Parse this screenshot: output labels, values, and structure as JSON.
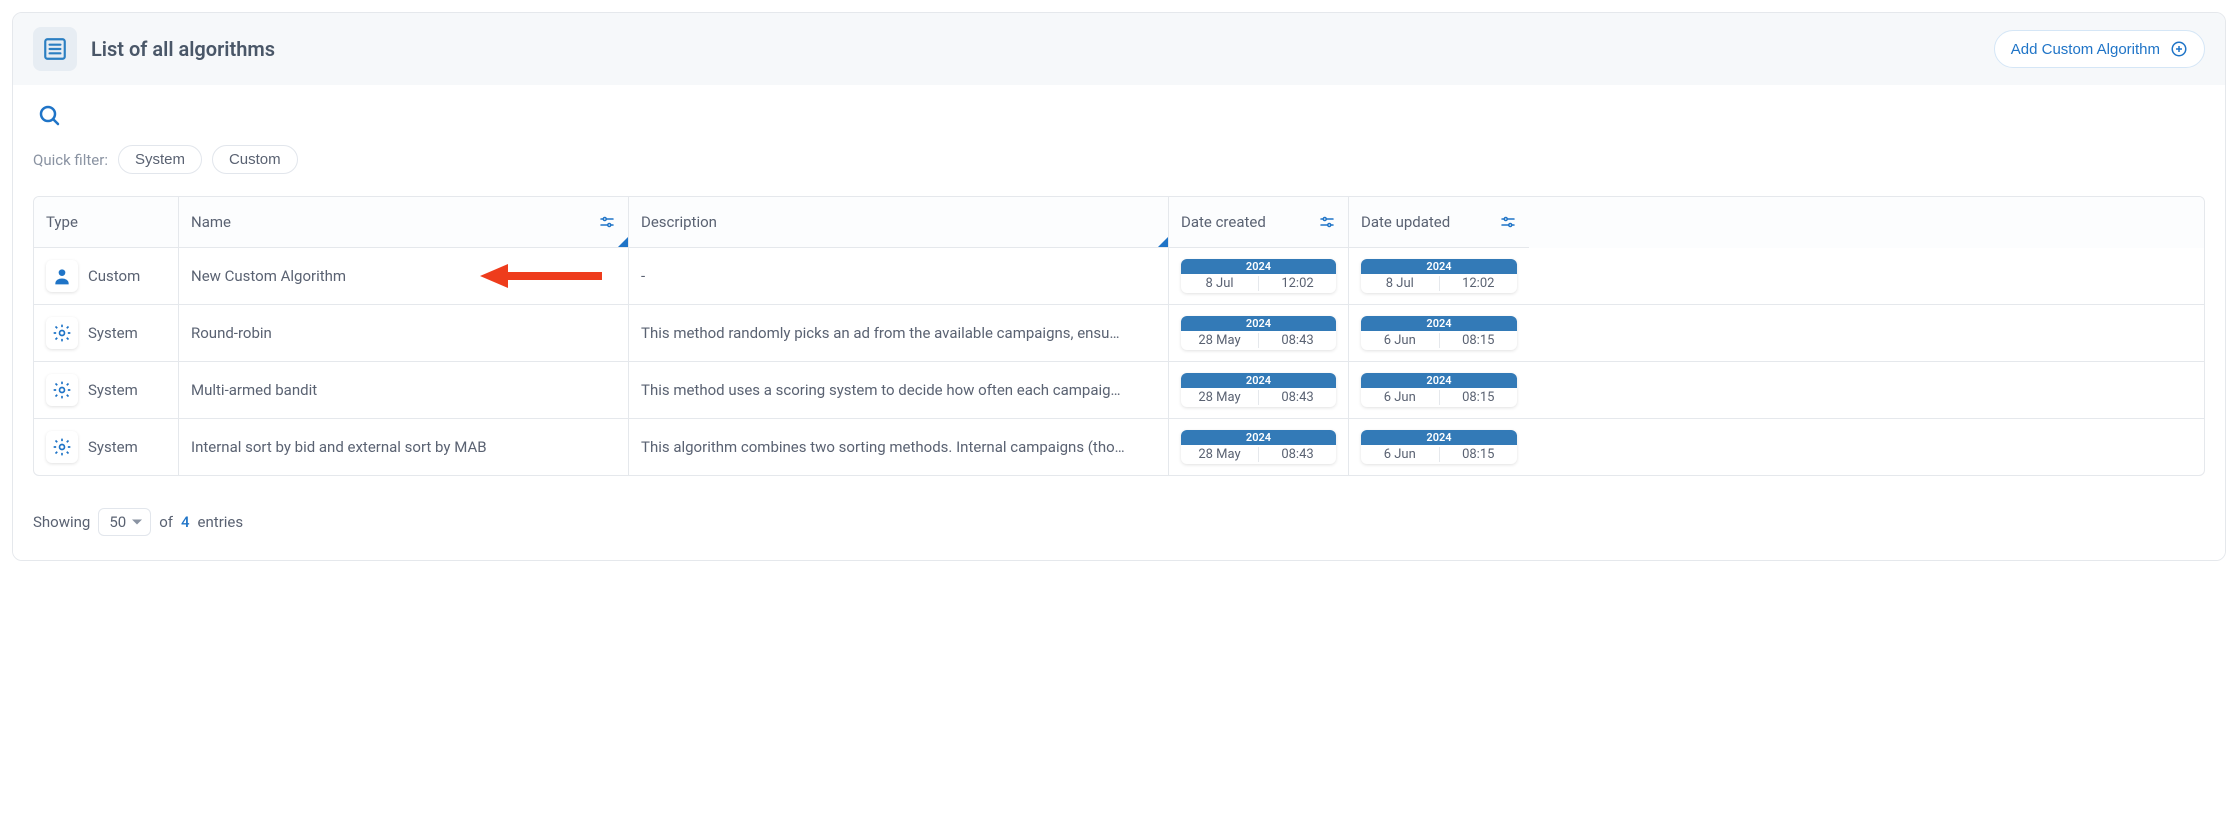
{
  "header": {
    "title": "List of all algorithms",
    "add_button_label": "Add Custom Algorithm"
  },
  "filters": {
    "quick_filter_label": "Quick filter:",
    "chips": [
      "System",
      "Custom"
    ]
  },
  "columns": {
    "type": "Type",
    "name": "Name",
    "description": "Description",
    "date_created": "Date created",
    "date_updated": "Date updated"
  },
  "rows": [
    {
      "type_label": "Custom",
      "type_icon": "user-icon",
      "name": "New Custom Algorithm",
      "description": "-",
      "created": {
        "year": "2024",
        "date": "8 Jul",
        "time": "12:02"
      },
      "updated": {
        "year": "2024",
        "date": "8 Jul",
        "time": "12:02"
      },
      "highlighted": true
    },
    {
      "type_label": "System",
      "type_icon": "gear-icon",
      "name": "Round-robin",
      "description": "This method randomly picks an ad from the available campaigns, ensu…",
      "created": {
        "year": "2024",
        "date": "28 May",
        "time": "08:43"
      },
      "updated": {
        "year": "2024",
        "date": "6 Jun",
        "time": "08:15"
      },
      "highlighted": false
    },
    {
      "type_label": "System",
      "type_icon": "gear-icon",
      "name": "Multi-armed bandit",
      "description": "This method uses a scoring system to decide how often each campaig…",
      "created": {
        "year": "2024",
        "date": "28 May",
        "time": "08:43"
      },
      "updated": {
        "year": "2024",
        "date": "6 Jun",
        "time": "08:15"
      },
      "highlighted": false
    },
    {
      "type_label": "System",
      "type_icon": "gear-icon",
      "name": "Internal sort by bid and external sort by MAB",
      "description": "This algorithm combines two sorting methods. Internal campaigns (tho…",
      "created": {
        "year": "2024",
        "date": "28 May",
        "time": "08:43"
      },
      "updated": {
        "year": "2024",
        "date": "6 Jun",
        "time": "08:15"
      },
      "highlighted": false
    }
  ],
  "pager": {
    "showing_label": "Showing",
    "page_size": "50",
    "of_label": "of",
    "count": "4",
    "entries_label": "entries"
  },
  "colors": {
    "accent_blue": "#1f74c7",
    "pill_blue": "#337ab7",
    "arrow_red": "#ee3c1c"
  }
}
